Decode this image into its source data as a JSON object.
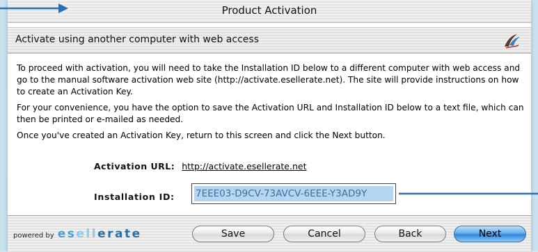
{
  "window": {
    "title": "Product Activation"
  },
  "section": {
    "title": "Activate using another computer with web access",
    "logo_icon": "esellerate-swoosh-icon"
  },
  "body": {
    "paragraph1": "To proceed with activation, you will need to take the Installation ID below to a different computer with web access and go to the manual software activation web site (http://activate.esellerate.net). The site will provide instructions on how to create an Activation Key.",
    "paragraph2": "For your convenience, you have the option to save the Activation URL and Installation ID below to a text file, which can then be printed or e-mailed as needed.",
    "paragraph3": "Once you've created an Activation Key, return to this screen and click the Next button."
  },
  "activation_url": {
    "label": "Activation URL:",
    "value": "http://activate.esellerate.net"
  },
  "installation_id": {
    "label": "Installation ID:",
    "value": "7EEE03-D9CV-73AVCV-6EEE-Y3AD9Y"
  },
  "footer": {
    "powered_by": "powered by",
    "brand": {
      "part1": "es",
      "part2": "ell",
      "part3": "erate"
    },
    "save_label": "Save",
    "cancel_label": "Cancel",
    "back_label": "Back",
    "next_label": "Next"
  },
  "colors": {
    "accent": "#2f85db",
    "selection": "#b4d6f2",
    "annotation_arrow": "#2a6fb0"
  }
}
